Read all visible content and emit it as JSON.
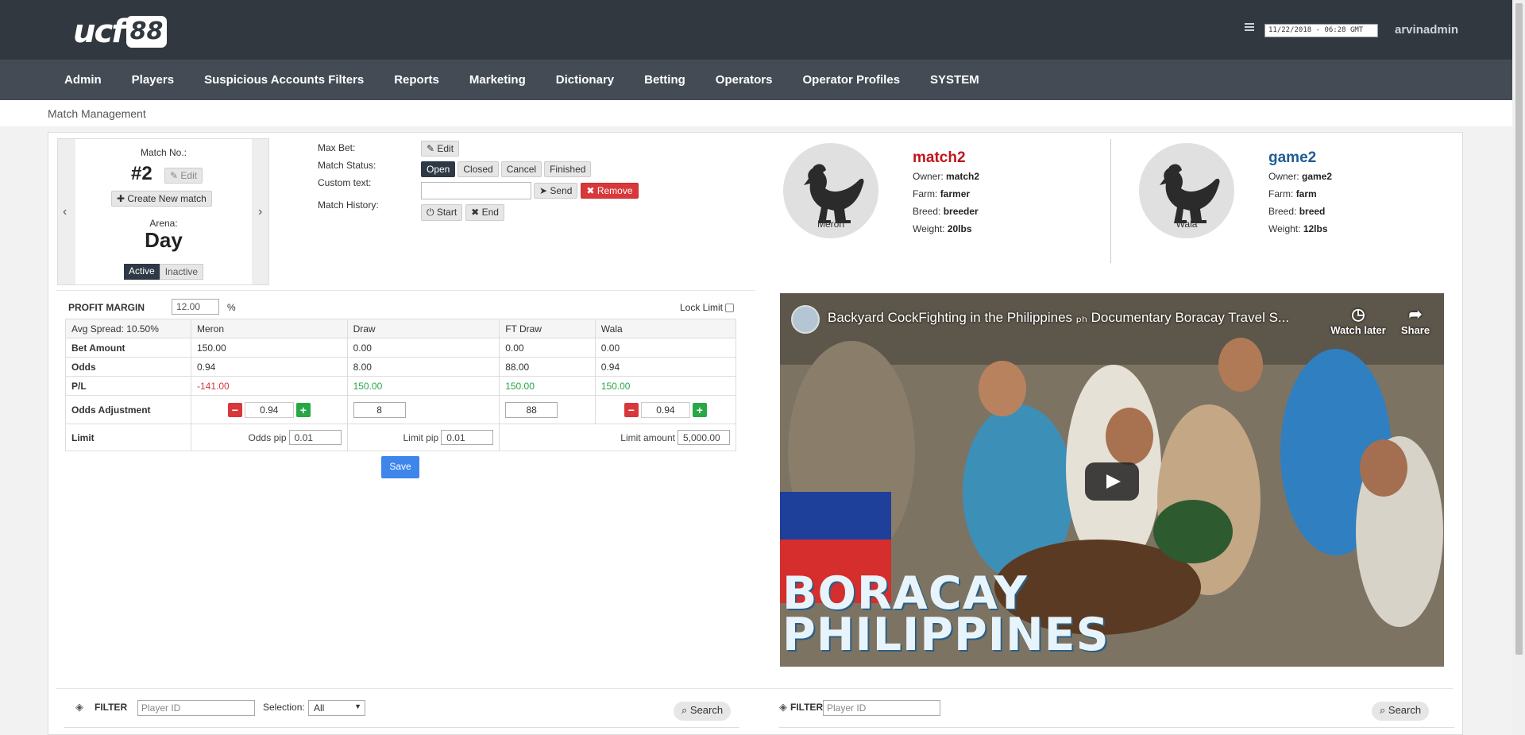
{
  "header": {
    "logo_text": "ucf",
    "logo_badge": "88",
    "datetime": "11/22/2018 - 06:28 GMT",
    "username": "arvinadmin"
  },
  "nav": {
    "items": [
      "Admin",
      "Players",
      "Suspicious Accounts Filters",
      "Reports",
      "Marketing",
      "Dictionary",
      "Betting",
      "Operators",
      "Operator Profiles",
      "SYSTEM"
    ]
  },
  "breadcrumb": "Match Management",
  "match": {
    "match_no_label": "Match No.:",
    "match_no": "#2",
    "edit_label": "Edit",
    "create_label": "Create New match",
    "arena_label": "Arena:",
    "arena": "Day",
    "active_label": "Active",
    "inactive_label": "Inactive"
  },
  "controls": {
    "max_bet_label": "Max Bet:",
    "edit_label": "Edit",
    "status_label": "Match Status:",
    "status_options": [
      "Open",
      "Closed",
      "Cancel",
      "Finished"
    ],
    "status_selected": "Open",
    "custom_text_label": "Custom text:",
    "custom_text_value": "",
    "send_label": "Send",
    "remove_label": "Remove",
    "history_label": "Match History:",
    "start_label": "Start",
    "end_label": "End"
  },
  "fighters": {
    "meron": {
      "caption": "Meron",
      "name": "match2",
      "owner_label": "Owner:",
      "owner": "match2",
      "farm_label": "Farm:",
      "farm": "farmer",
      "breed_label": "Breed:",
      "breed": "breeder",
      "weight_label": "Weight:",
      "weight": "20lbs",
      "name_color": "#c0151b"
    },
    "wala": {
      "caption": "Wala",
      "name": "game2",
      "owner_label": "Owner:",
      "owner": "game2",
      "farm_label": "Farm:",
      "farm": "farm",
      "breed_label": "Breed:",
      "breed": "breed",
      "weight_label": "Weight:",
      "weight": "12lbs",
      "name_color": "#1f5d94"
    }
  },
  "profit": {
    "label": "PROFIT MARGIN",
    "value": "12.00",
    "unit": "%",
    "lock_label": "Lock Limit"
  },
  "odds_table": {
    "headers": [
      "Avg Spread: 10.50%",
      "Meron",
      "Draw",
      "FT Draw",
      "Wala"
    ],
    "rows": {
      "bet_amount": {
        "label": "Bet Amount",
        "values": [
          "150.00",
          "0.00",
          "0.00",
          "0.00"
        ]
      },
      "odds": {
        "label": "Odds",
        "values": [
          "0.94",
          "8.00",
          "88.00",
          "0.94"
        ]
      },
      "pl": {
        "label": "P/L",
        "values": [
          "-141.00",
          "150.00",
          "150.00",
          "150.00"
        ]
      },
      "adjustment": {
        "label": "Odds Adjustment",
        "values": [
          "0.94",
          "8",
          "88",
          "0.94"
        ]
      },
      "limit": {
        "label": "Limit",
        "odds_pip_label": "Odds pip",
        "odds_pip": "0.01",
        "limit_pip_label": "Limit pip",
        "limit_pip": "0.01",
        "limit_amount_label": "Limit amount",
        "limit_amount": "5,000.00"
      }
    },
    "save_label": "Save"
  },
  "video": {
    "title": "Backyard CockFighting in the Philippines ₚₕ Documentary Boracay Travel S...",
    "watch_later": "Watch later",
    "share": "Share",
    "overlay_line1": "BORACAY",
    "overlay_line2": "PHILIPPINES"
  },
  "filters": {
    "left": {
      "label": "FILTER",
      "placeholder": "Player ID",
      "selection_label": "Selection:",
      "selection_value": "All",
      "search_label": "Search"
    },
    "right": {
      "label": "FILTER",
      "placeholder": "Player ID",
      "search_label": "Search"
    }
  },
  "colors": {
    "topbar": "#323840",
    "navbar": "#444b54",
    "red": "#d9383a",
    "green": "#28a745",
    "save": "#3e85ec"
  }
}
